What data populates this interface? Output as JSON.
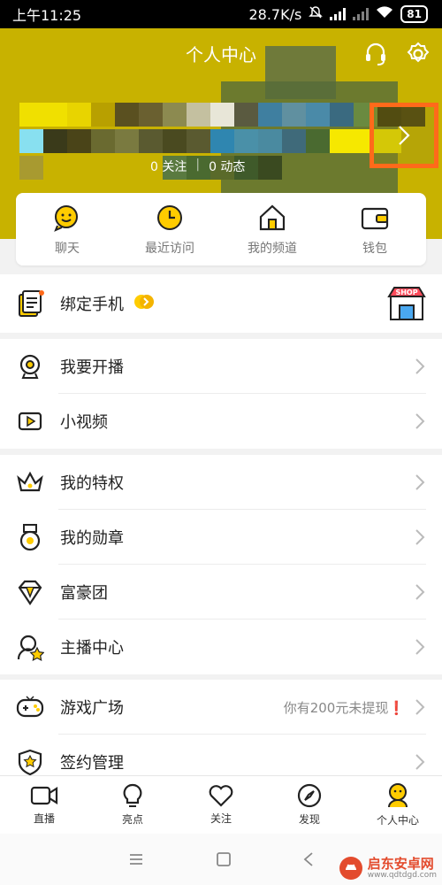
{
  "status_bar": {
    "time": "上午11:25",
    "speed": "28.7K/s",
    "battery": "81"
  },
  "header": {
    "title": "个人中心",
    "stat_follow": "0 关注",
    "stat_posts": "0 动态"
  },
  "quick_actions": [
    {
      "label": "聊天",
      "icon": "chat-bubble-icon"
    },
    {
      "label": "最近访问",
      "icon": "clock-icon"
    },
    {
      "label": "我的频道",
      "icon": "house-icon"
    },
    {
      "label": "钱包",
      "icon": "wallet-icon"
    }
  ],
  "bind_phone": {
    "label": "绑定手机",
    "shop_badge": "SHOP"
  },
  "section1": [
    {
      "label": "我要开播",
      "icon": "webcam-icon"
    },
    {
      "label": "小视频",
      "icon": "video-icon"
    }
  ],
  "section2": [
    {
      "label": "我的特权",
      "icon": "crown-icon"
    },
    {
      "label": "我的勋章",
      "icon": "medal-icon"
    },
    {
      "label": "富豪团",
      "icon": "gem-icon"
    },
    {
      "label": "主播中心",
      "icon": "anchor-star-icon"
    }
  ],
  "section3": [
    {
      "label": "游戏广场",
      "icon": "gamepad-icon",
      "hint": "你有200元未提现❗"
    },
    {
      "label": "签约管理",
      "icon": "shield-star-icon"
    }
  ],
  "bottom_nav": [
    {
      "label": "直播",
      "icon": "camera-icon"
    },
    {
      "label": "亮点",
      "icon": "bulb-icon"
    },
    {
      "label": "关注",
      "icon": "heart-icon"
    },
    {
      "label": "发现",
      "icon": "compass-icon"
    },
    {
      "label": "个人中心",
      "icon": "person-icon"
    }
  ],
  "watermark": {
    "title": "启东安卓网",
    "url": "www.qdtdgd.com"
  },
  "colors": {
    "accent": "#c8b200",
    "highlight": "#ff6a1a",
    "yellow": "#ffcc00"
  }
}
